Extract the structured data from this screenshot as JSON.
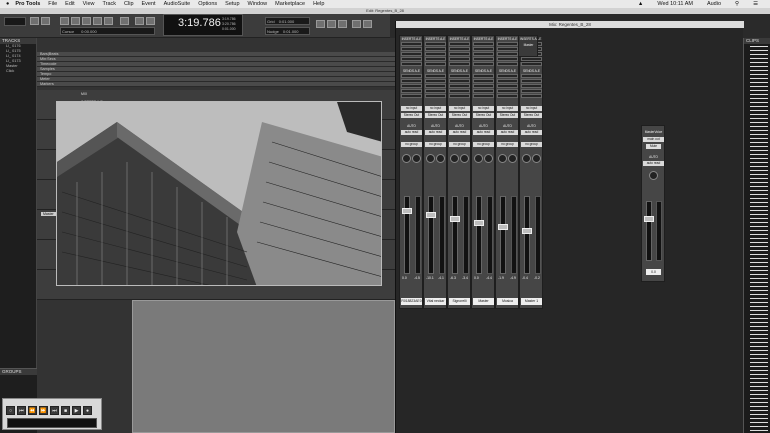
{
  "menubar": {
    "app": "Pro Tools",
    "items": [
      "File",
      "Edit",
      "View",
      "Track",
      "Clip",
      "Event",
      "AudioSuite",
      "Options",
      "Setup",
      "Window",
      "Marketplace",
      "Help"
    ],
    "clock": "Wed 10:11 AM",
    "audio_label": "Audio"
  },
  "edit_window": {
    "title": "Edit: Regentes_B_28",
    "counter_main": "3:19.786",
    "counter_sub": [
      "3:19.786",
      "3:20.786",
      "0:01.000"
    ],
    "grid_label": "Grid",
    "nudge_label": "Nudge",
    "grid_value": "0:01.000",
    "nudge_value": "0:01.000",
    "cursor_label": "Cursor",
    "cursor_value": "0:00.000"
  },
  "tracks_pane": {
    "header": "TRACKS",
    "items": [
      "Ll_ 0176",
      "Ll_ 0175",
      "Ll_ 0174",
      "Ll_ 0173",
      "Master",
      "Click"
    ]
  },
  "groups_pane": {
    "header": "GROUPS"
  },
  "rulers": [
    "Bars|Beats",
    "Min:Secs",
    "Timecode",
    "Samples",
    "Tempo",
    "Meter",
    "Markers"
  ],
  "track_labels": [
    "MIX",
    "INSERTS A-E",
    "Master"
  ],
  "mix_window": {
    "title": "Mix: Regentes_B_28",
    "strips": [
      {
        "inserts_label": "INSERTS A-E",
        "sends_label": "SENDS A-E",
        "io": "no input",
        "out": "Stereo Out",
        "auto": "AUTO",
        "auto_mode": "auto read",
        "group": "no group",
        "vol": "0.0",
        "peak": "-4.5",
        "name": "R018823AE0"
      },
      {
        "inserts_label": "INSERTS A-E",
        "sends_label": "SENDS A-E",
        "io": "no input",
        "out": "Stereo Out",
        "auto": "AUTO",
        "auto_mode": "auto read",
        "group": "no group",
        "vol": "-10.1",
        "peak": "-4.1",
        "name": "Vital neckar"
      },
      {
        "inserts_label": "INSERTS A-E",
        "sends_label": "SENDS A-E",
        "io": "no input",
        "out": "Stereo Out",
        "auto": "AUTO",
        "auto_mode": "auto read",
        "group": "no group",
        "vol": "-6.3",
        "peak": "-3.4",
        "name": "Signorelli"
      },
      {
        "inserts_label": "INSERTS A-E",
        "sends_label": "SENDS A-E",
        "io": "no input",
        "out": "Stereo Out",
        "auto": "AUTO",
        "auto_mode": "auto read",
        "group": "no group",
        "vol": "0.0",
        "peak": "-4.4",
        "name": "Master"
      },
      {
        "inserts_label": "INSERTS A-E",
        "sends_label": "SENDS A-E",
        "io": "no input",
        "out": "Stereo Out",
        "auto": "AUTO",
        "auto_mode": "auto read",
        "group": "no group",
        "vol": "-1.9",
        "peak": "-4.9",
        "name": "Musica"
      },
      {
        "inserts_label": "INSERTS A-E",
        "sends_label": "SENDS A-E",
        "io": "no input",
        "out": "Stereo Out",
        "auto": "AUTO",
        "auto_mode": "auto read",
        "group": "no group",
        "vol": "-0.4",
        "peak": "-0.2",
        "name": "Master 1"
      }
    ],
    "extra_strip": {
      "inserts_label": "INSERTS A-E",
      "sub": "Master"
    }
  },
  "floating_strip": {
    "name": "MasterVoice",
    "io": "main out",
    "mute_label": "Mute",
    "auto": "AUTO",
    "auto_mode": "auto read",
    "vol": "0.0"
  },
  "clips_pane": {
    "header": "CLIPS"
  },
  "colors": {
    "bg": "#2a2a2a",
    "menubar": "#e9e9e9",
    "strip": "#464646",
    "name_plate": "#eeeeee"
  }
}
